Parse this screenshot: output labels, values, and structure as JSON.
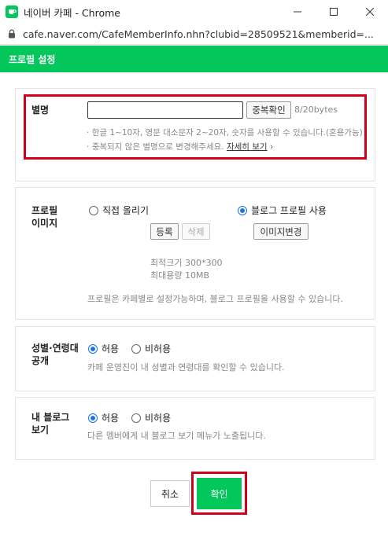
{
  "window": {
    "title": "네이버 카페 - Chrome",
    "url": "cafe.naver.com/CafeMemberInfo.nhn?clubid=28509521&memberid=..."
  },
  "header": {
    "title": "프로필 설정"
  },
  "nickname": {
    "label": "별명",
    "value": "",
    "dup_button": "중복확인",
    "byte_count": "8/20bytes",
    "hint1": "한글 1~10자, 영문 대소문자 2~20자, 숫자를 사용할 수 있습니다.(혼용가능)",
    "hint2": "중복되지 않은 별명으로 변경해주세요.",
    "hint2_link": "자세히 보기"
  },
  "profile_image": {
    "label_line1": "프로필",
    "label_line2": "이미지",
    "option_direct": "직접 올리기",
    "option_blog": "블로그 프로필 사용",
    "selected": "blog",
    "register_button": "등록",
    "delete_button": "삭제",
    "change_button": "이미지변경",
    "min_size": "최적크기 300*300",
    "max_size": "최대용량 10MB",
    "note": "프로필은 카페별로 설정가능하며, 블로그 프로필을 사용할 수 있습니다."
  },
  "gender_age": {
    "label_line1": "성별·연령대",
    "label_line2": "공개",
    "allow": "허용",
    "deny": "비허용",
    "selected": "allow",
    "note": "카페 운영진이 내 성별과 연령대를 확인할 수 있습니다."
  },
  "my_blog": {
    "label_line1": "내 블로그",
    "label_line2": "보기",
    "allow": "허용",
    "deny": "비허용",
    "selected": "allow",
    "note": "다른 멤버에게 내 블로그 보기 메뉴가 노출됩니다."
  },
  "footer": {
    "cancel": "취소",
    "confirm": "확인"
  },
  "colors": {
    "brand_green": "#03c75a",
    "highlight_red": "#d0021b",
    "radio_blue": "#1a73e8"
  },
  "icons": [
    "naver-cafe-favicon",
    "minimize-icon",
    "maximize-icon",
    "close-icon",
    "lock-icon"
  ]
}
